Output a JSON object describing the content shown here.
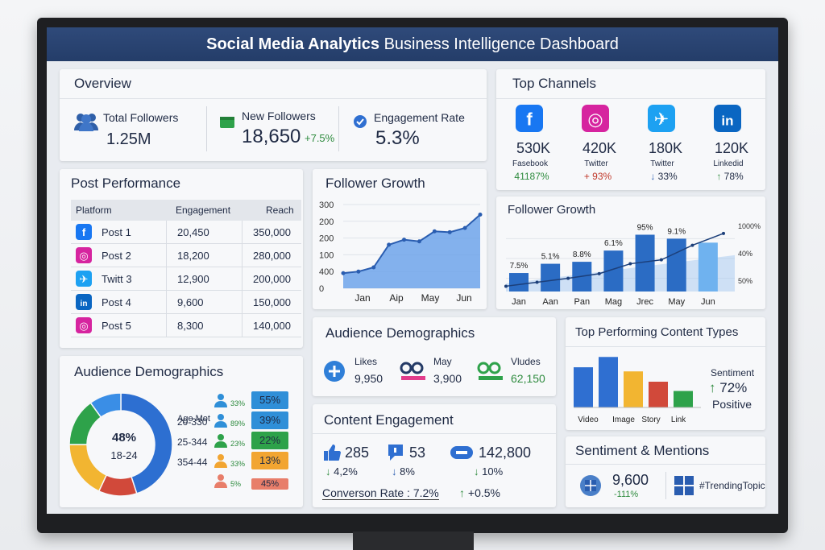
{
  "header": {
    "title_bold": "Social Media Analytics",
    "title_rest": " Business Intelligence Dashboard"
  },
  "overview": {
    "title": "Overview",
    "total_followers_label": "Total Followers",
    "total_followers_value": "1.25M",
    "new_followers_label": "New Followers",
    "new_followers_value": "18,650",
    "new_followers_change": "+7.5%",
    "engagement_label": "Engagement Rate",
    "engagement_value": "5.3%"
  },
  "top_channels": {
    "title": "Top Channels",
    "items": [
      {
        "value": "530K",
        "name": "Fasebook",
        "change": "41187%",
        "icon": "facebook-icon",
        "color": "#1877f2"
      },
      {
        "value": "420K",
        "name": "Twitter",
        "change": "+ 93%",
        "icon": "instagram-icon",
        "color": "#d6249f"
      },
      {
        "value": "180K",
        "name": "Twitter",
        "change": "33%",
        "icon": "twitter-icon",
        "color": "#1da1f2"
      },
      {
        "value": "120K",
        "name": "Linkedid",
        "change": "78%",
        "icon": "linkedin-icon",
        "color": "#0a66c2"
      }
    ]
  },
  "post_performance": {
    "title": "Post Performance",
    "columns": [
      "Platform",
      "Engagement",
      "Reach"
    ],
    "rows": [
      {
        "post": "Post 1",
        "engagement": "20,450",
        "reach": "350,000",
        "icon": "facebook-icon"
      },
      {
        "post": "Post 2",
        "engagement": "18,200",
        "reach": "280,000",
        "icon": "instagram-icon"
      },
      {
        "post": "Twitt 3",
        "engagement": "12,900",
        "reach": "200,000",
        "icon": "twitter-icon"
      },
      {
        "post": "Post 4",
        "engagement": "9,600",
        "reach": "150,000",
        "icon": "linkedin-icon"
      },
      {
        "post": "Post 5",
        "engagement": "8,300",
        "reach": "140,000",
        "icon": "instagram-icon"
      }
    ]
  },
  "chart_data": [
    {
      "type": "area",
      "title": "Follower Growth",
      "categories": [
        "Jan",
        "Aip",
        "May",
        "Jun"
      ],
      "y_ticks": [
        "300",
        "200",
        "200",
        "100",
        "400",
        "0"
      ],
      "x": [
        0,
        1,
        2,
        3,
        4,
        5,
        6,
        7,
        8,
        9
      ],
      "values": [
        0.18,
        0.2,
        0.25,
        0.52,
        0.58,
        0.56,
        0.68,
        0.67,
        0.72,
        0.88
      ],
      "grid": true
    },
    {
      "type": "bar",
      "title": "Follower Growth",
      "categories": [
        "Jan",
        "Aan",
        "Pan",
        "Mag",
        "Jrec",
        "May",
        "Jun"
      ],
      "values": [
        0.28,
        0.42,
        0.45,
        0.62,
        0.86,
        0.8,
        0.74
      ],
      "bar_labels": [
        "7.5%",
        "5.1%",
        "8.8%",
        "6.1%",
        "95%",
        "9.1%",
        ""
      ],
      "line_values": [
        0.08,
        0.14,
        0.2,
        0.27,
        0.42,
        0.48,
        0.7,
        0.88
      ],
      "right_ticks": [
        "1000%",
        "40%",
        "50%"
      ],
      "grid": true
    },
    {
      "type": "pie",
      "title": "Audience Demographics",
      "values": [
        45,
        12,
        18,
        15,
        10
      ],
      "colors": [
        "#2d6fd1",
        "#d1493a",
        "#f2b531",
        "#2ea24a",
        "#3a8ee6"
      ],
      "center_top": "48%",
      "center_bottom": "18-24"
    },
    {
      "type": "bar",
      "title": "Top Performing Content Types",
      "categories": [
        "Video",
        "Image",
        "Story",
        "Link"
      ],
      "values": [
        0.78,
        0.98,
        0.7,
        0.5,
        0.32
      ],
      "colors": [
        "#2f6fd1",
        "#2f6fd1",
        "#f2b531",
        "#d1493a",
        "#2ea24a"
      ]
    }
  ],
  "demographics_left": {
    "age_label": "Age Mot",
    "rows": [
      {
        "label": "",
        "small": "33%",
        "value": "55%",
        "color": "#2f8fd8"
      },
      {
        "label": "20-330",
        "small": "89%",
        "value": "39%",
        "color": "#2f8fd8"
      },
      {
        "label": "25-344",
        "small": "23%",
        "value": "22%",
        "color": "#2ea24a"
      },
      {
        "label": "354-44",
        "small": "33%",
        "value": "13%",
        "color": "#f2a531"
      },
      {
        "label": "",
        "small": "5%",
        "value": "45%",
        "color": "#e87e6a"
      }
    ]
  },
  "audience_mid": {
    "title": "Audience Demographics",
    "likes_label": "Likes",
    "likes_value": "9,950",
    "may_label": "May",
    "may_value": "3,900",
    "vludes_label": "Vludes",
    "vludes_value": "62,150"
  },
  "content_engagement": {
    "title": "Content Engagement",
    "likes_value": "285",
    "likes_change": "4,2%",
    "comments_value": "53",
    "comments_change": "8%",
    "shares_value": "142,800",
    "shares_change": "10%",
    "conversion_label": "Converson Rate : 7.2%",
    "conversion_change": "+0.5%"
  },
  "sentiment_side": {
    "label": "Sentiment",
    "value": "72%",
    "sub": "Positive"
  },
  "sentiment_mentions": {
    "title": "Sentiment & Mentions",
    "value": "9,600",
    "change": "-111%",
    "hashtag": "#TrendingTopic"
  }
}
